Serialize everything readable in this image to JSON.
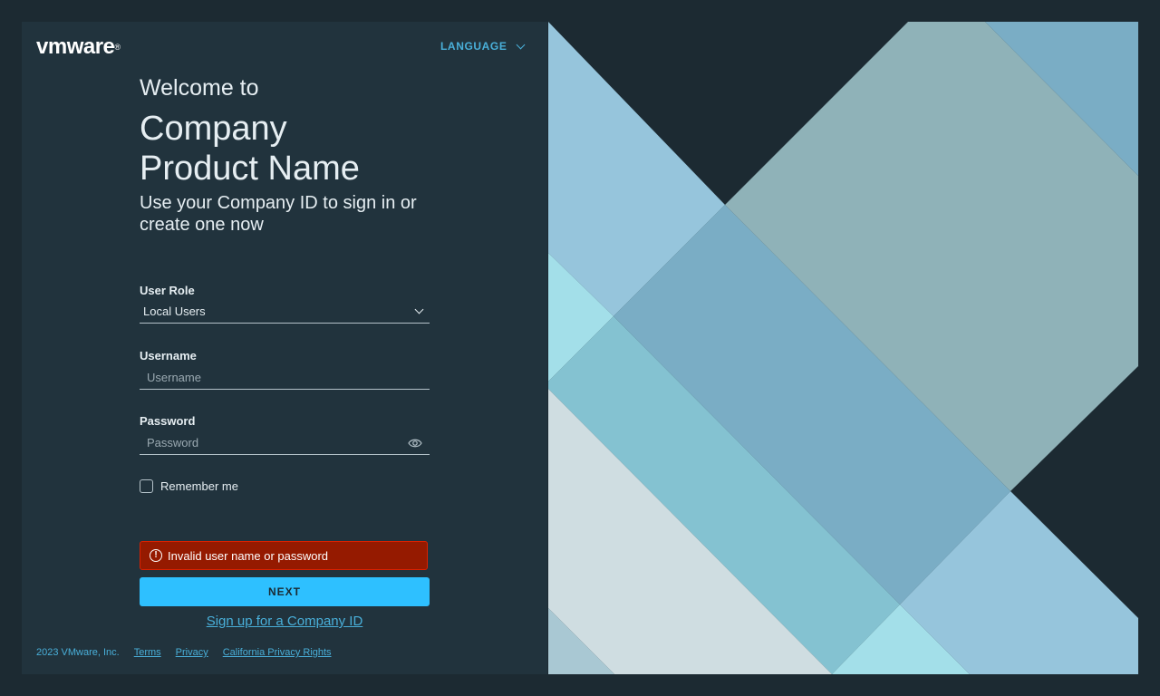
{
  "brand": {
    "logo": "vmware",
    "logo_mark": "®"
  },
  "header": {
    "language_label": "LANGUAGE"
  },
  "intro": {
    "welcome": "Welcome to",
    "product_line1": "Company",
    "product_line2": "Product Name",
    "subtitle": "Use your Company ID to sign in or create one now"
  },
  "form": {
    "role_label": "User Role",
    "role_value": "Local Users",
    "username_label": "Username",
    "username_placeholder": "Username",
    "password_label": "Password",
    "password_placeholder": "Password",
    "remember_label": "Remember me",
    "error_message": "Invalid user name or password",
    "next_label": "NEXT",
    "signup_label": "Sign up for a Company ID"
  },
  "footer": {
    "copyright": "2023 VMware, Inc.",
    "terms": "Terms",
    "privacy": "Privacy",
    "ca_privacy": "California Privacy Rights"
  },
  "colors": {
    "background": "#1c2a32",
    "panel": "#21333d",
    "accent": "#2ec0ff",
    "link": "#49afd9",
    "error_bg": "#951a00"
  }
}
